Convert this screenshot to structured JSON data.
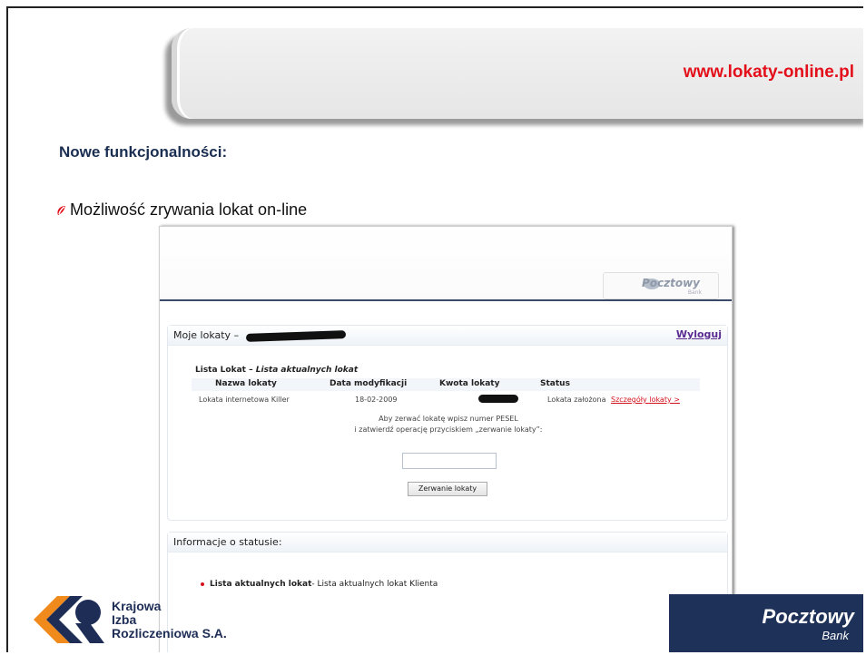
{
  "banner": {
    "url": "www.lokaty-online.pl"
  },
  "slide": {
    "heading": "Nowe funkcjonalności:",
    "bullet": "Możliwość zrywania lokat on-line"
  },
  "screenshot": {
    "logo": {
      "name": "Pocztowy",
      "sub": "Bank"
    },
    "main": {
      "title": "Moje lokaty –",
      "logout": "Wyloguj",
      "list_title": "Lista Lokat",
      "list_subtitle": "Lista aktualnych lokat",
      "columns": [
        "Nazwa lokaty",
        "Data modyfikacji",
        "Kwota lokaty",
        "Status"
      ],
      "row": {
        "name": "Lokata internetowa Killer",
        "date": "18-02-2009",
        "status": "Lokata założona",
        "details": "Szczegóły lokaty >"
      },
      "hint_line1": "Aby zerwać lokatę wpisz numer PESEL",
      "hint_line2": "i zatwierdź operację przyciskiem „zerwanie lokaty”:",
      "pesel_value": "",
      "button": "Zerwanie lokaty"
    },
    "info": {
      "title": "Informacje o statusie:",
      "item_bold": "Lista aktualnych lokat",
      "item_text": " - Lista aktualnych lokat Klienta"
    }
  },
  "footer": {
    "kir": {
      "line1": "Krajowa",
      "line2": "Izba",
      "line3": "Rozliczeniowa S.A."
    },
    "pb": {
      "name": "Pocztowy",
      "sub": "Bank"
    }
  },
  "colors": {
    "accent": "#e3101b",
    "navy": "#1e3158",
    "link": "#5a2c91"
  }
}
